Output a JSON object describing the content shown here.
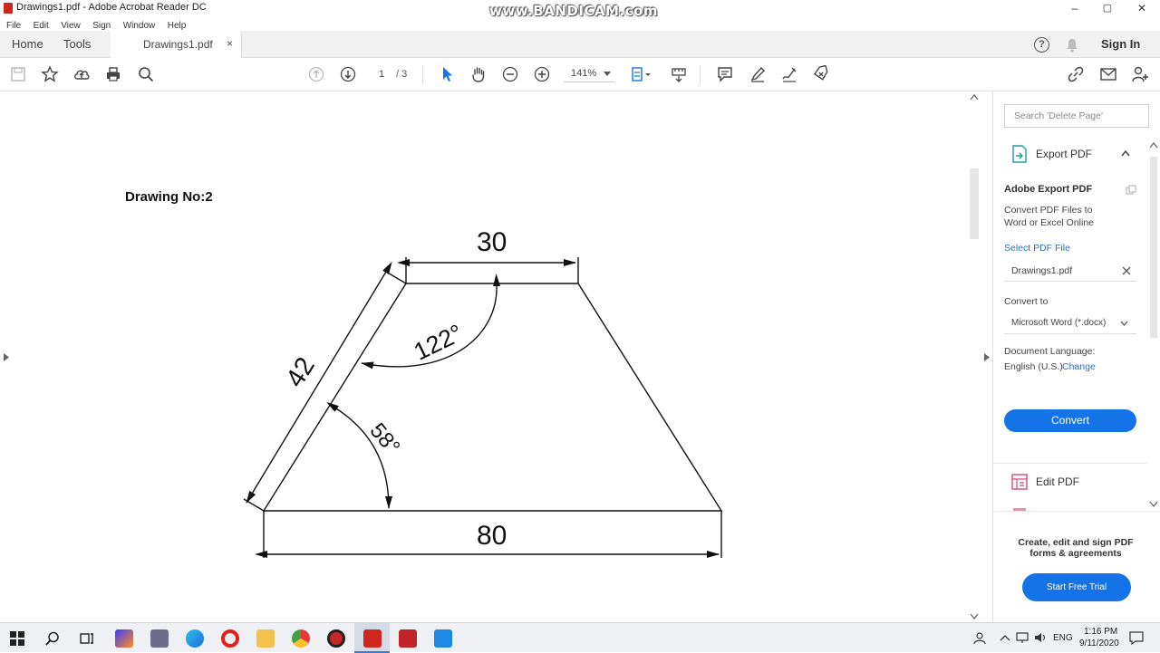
{
  "window": {
    "title": "Drawings1.pdf - Adobe Acrobat Reader DC",
    "watermark": "www.BANDICAM.com",
    "controls": {
      "minimize": "–",
      "maximize": "▢",
      "close": "✕"
    }
  },
  "menu": [
    "File",
    "Edit",
    "View",
    "Sign",
    "Window",
    "Help"
  ],
  "tabs": {
    "home": "Home",
    "tools": "Tools",
    "document": "Drawings1.pdf",
    "close": "×",
    "sign_in": "Sign In",
    "help": "?"
  },
  "toolbar": {
    "current_page": "1",
    "page_total": "/ 3",
    "zoom": "141%"
  },
  "drawing": {
    "title": "Drawing No:2",
    "top_width": "30",
    "bottom_width": "80",
    "side_length": "42",
    "obtuse_angle": "122°",
    "acute_angle": "58°"
  },
  "right_panel": {
    "search_placeholder": "Search 'Delete Page'",
    "export_title": "Export PDF",
    "adobe_export_heading": "Adobe Export PDF",
    "description": "Convert PDF Files to Word or Excel Online",
    "select_label": "Select PDF File",
    "selected_file": "Drawings1.pdf",
    "convert_to_label": "Convert to",
    "convert_format": "Microsoft Word (*.docx)",
    "language_label": "Document Language:",
    "language_value": "English (U.S.)",
    "change_link": "Change",
    "convert_button": "Convert",
    "edit_pdf": "Edit PDF",
    "promo": "Create, edit and sign PDF forms & agreements",
    "trial_button": "Start Free Trial"
  },
  "taskbar": {
    "time": "1:16 PM",
    "date": "9/11/2020",
    "lang": "ENG"
  },
  "colors": {
    "accent_blue": "#1473e6",
    "acrobat_red": "#d0261c",
    "link_blue": "#2c6fbd"
  }
}
